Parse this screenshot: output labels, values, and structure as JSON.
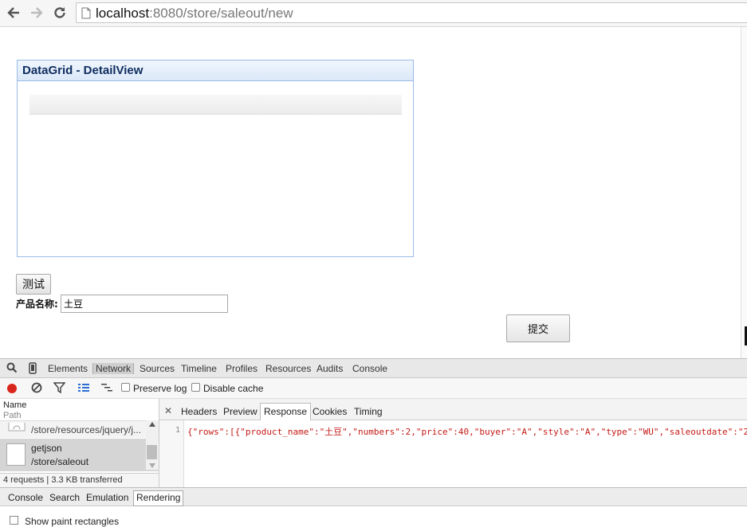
{
  "browser": {
    "url_host": "localhost",
    "url_path": ":8080/store/saleout/new"
  },
  "page": {
    "panel_title": "DataGrid - DetailView",
    "test_button": "测试",
    "product_label": "产品名称:",
    "product_value": "土豆",
    "submit_button": "提交"
  },
  "devtools": {
    "tabs": [
      "Elements",
      "Network",
      "Sources",
      "Timeline",
      "Profiles",
      "Resources",
      "Audits",
      "Console"
    ],
    "active_tab": "Network",
    "preserve_log": "Preserve log",
    "disable_cache": "Disable cache",
    "columns": {
      "name": "Name",
      "path": "Path"
    },
    "requests": [
      {
        "name": "",
        "path": "/store/resources/jquery/j..."
      },
      {
        "name": "getjson",
        "path": "/store/saleout"
      }
    ],
    "summary": "4 requests | 3.3 KB transferred",
    "detail_tabs": [
      "Headers",
      "Preview",
      "Response",
      "Cookies",
      "Timing"
    ],
    "active_detail_tab": "Response",
    "response_line_number": "1",
    "response_text": "{\"rows\":[{\"product_name\":\"土豆\",\"numbers\":2,\"price\":40,\"buyer\":\"A\",\"style\":\"A\",\"type\":\"WU\",\"saleoutdate\":\"2",
    "drawer_tabs": [
      "Console",
      "Search",
      "Emulation",
      "Rendering"
    ],
    "active_drawer_tab": "Rendering",
    "drawer_cut_text": "Show paint rectangles"
  },
  "colors": {
    "panel_border": "#99bbe8",
    "record": "#d9261c",
    "response_text": "#c41a16"
  }
}
